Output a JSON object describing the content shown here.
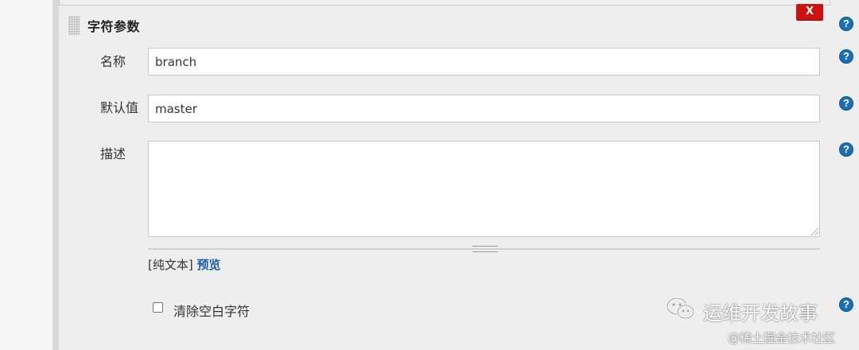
{
  "section": {
    "title": "字符参数",
    "delete_label": "X"
  },
  "help_icon": "?",
  "fields": {
    "name": {
      "label": "名称",
      "value": "branch"
    },
    "default_value": {
      "label": "默认值",
      "value": "master"
    },
    "description": {
      "label": "描述",
      "value": ""
    }
  },
  "format": {
    "plain_text": "[纯文本]",
    "preview_link": "预览"
  },
  "trim_option": {
    "label": "清除空白字符",
    "checked": false
  },
  "watermark": {
    "title": "运维开发故事",
    "subtitle": "@稀土掘金技术社区"
  },
  "colors": {
    "delete_red": "#cc1111",
    "help_blue": "#1b6fb5",
    "link_blue": "#1b5fa8"
  }
}
